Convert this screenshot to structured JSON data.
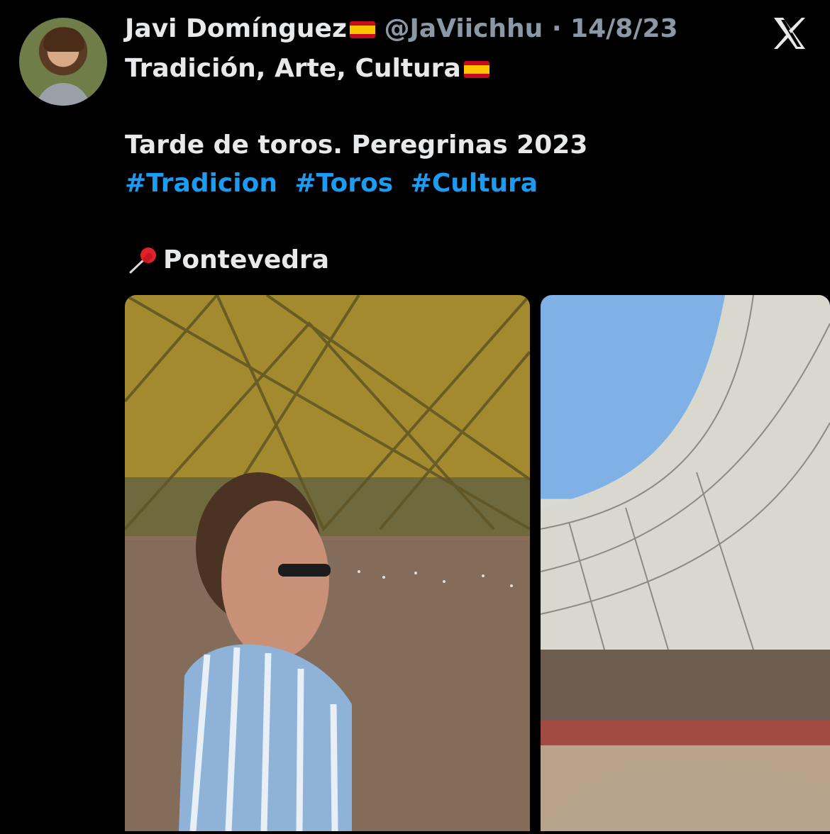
{
  "tweet": {
    "author_name": "Javi Domínguez",
    "author_flag": "🇪🇸",
    "handle": "@JaViichhu",
    "separator": "·",
    "date": "14/8/23",
    "line1": "Tradición, Arte, Cultura",
    "line1_flag": "🇪🇸",
    "line2": "Tarde de toros. Peregrinas 2023",
    "hashtags": [
      "#Tradicion",
      "#Toros",
      "#Cultura"
    ],
    "location_icon": "pushpin-icon",
    "location": "Pontevedra"
  },
  "ui": {
    "logo_icon": "x-logo-icon",
    "accent": "#1d9bf0",
    "text": "#e7e9ea",
    "muted": "#8b98a5"
  }
}
